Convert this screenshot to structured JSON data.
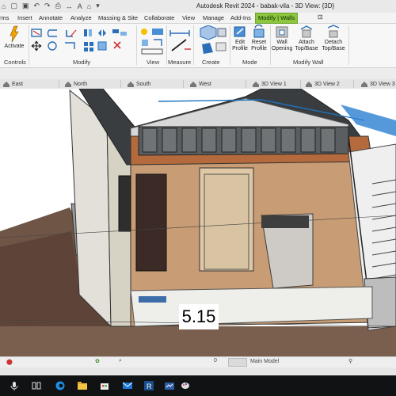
{
  "window": {
    "title": "Autodesk Revit 2024 - babak-vila - 3D View: {3D}"
  },
  "ribbon_tabs": [
    {
      "label": "rms"
    },
    {
      "label": "Insert"
    },
    {
      "label": "Annotate"
    },
    {
      "label": "Analyze"
    },
    {
      "label": "Massing & Site"
    },
    {
      "label": "Collaborate"
    },
    {
      "label": "View"
    },
    {
      "label": "Manage"
    },
    {
      "label": "Add-Ins"
    },
    {
      "label": "Modify | Walls"
    }
  ],
  "panels": {
    "controls": "Controls",
    "modify": "Modify",
    "view": "View",
    "measure": "Measure",
    "create": "Create",
    "mode": "Mode",
    "modify_wall": "Modify Wall"
  },
  "tools": {
    "activate": "Activate",
    "edit_profile": [
      "Edit",
      "Profile"
    ],
    "reset_profile": [
      "Reset",
      "Profile"
    ],
    "wall_opening": [
      "Wall",
      "Opening"
    ],
    "attach_top_base": [
      "Attach",
      "Top/Base"
    ],
    "detach_top_base": [
      "Detach",
      "Top/Base"
    ]
  },
  "view_tabs": [
    {
      "label": "East"
    },
    {
      "label": "North"
    },
    {
      "label": "South"
    },
    {
      "label": "West"
    },
    {
      "label": "3D View 1"
    },
    {
      "label": "3D View 2"
    },
    {
      "label": "3D View 3"
    }
  ],
  "canvas": {
    "dimension_label": "5.15"
  },
  "status": {
    "model": "Main Model",
    "value": "0"
  },
  "colors": {
    "context_tab": "#8dc63f",
    "taskbar": "#101214",
    "accent": "#1e73be"
  },
  "taskbar_icons": [
    "start-icon",
    "search-icon",
    "task-view-icon",
    "file-explorer-icon",
    "store-icon",
    "mail-icon",
    "revit-icon",
    "app-icon",
    "chrome-icon"
  ]
}
